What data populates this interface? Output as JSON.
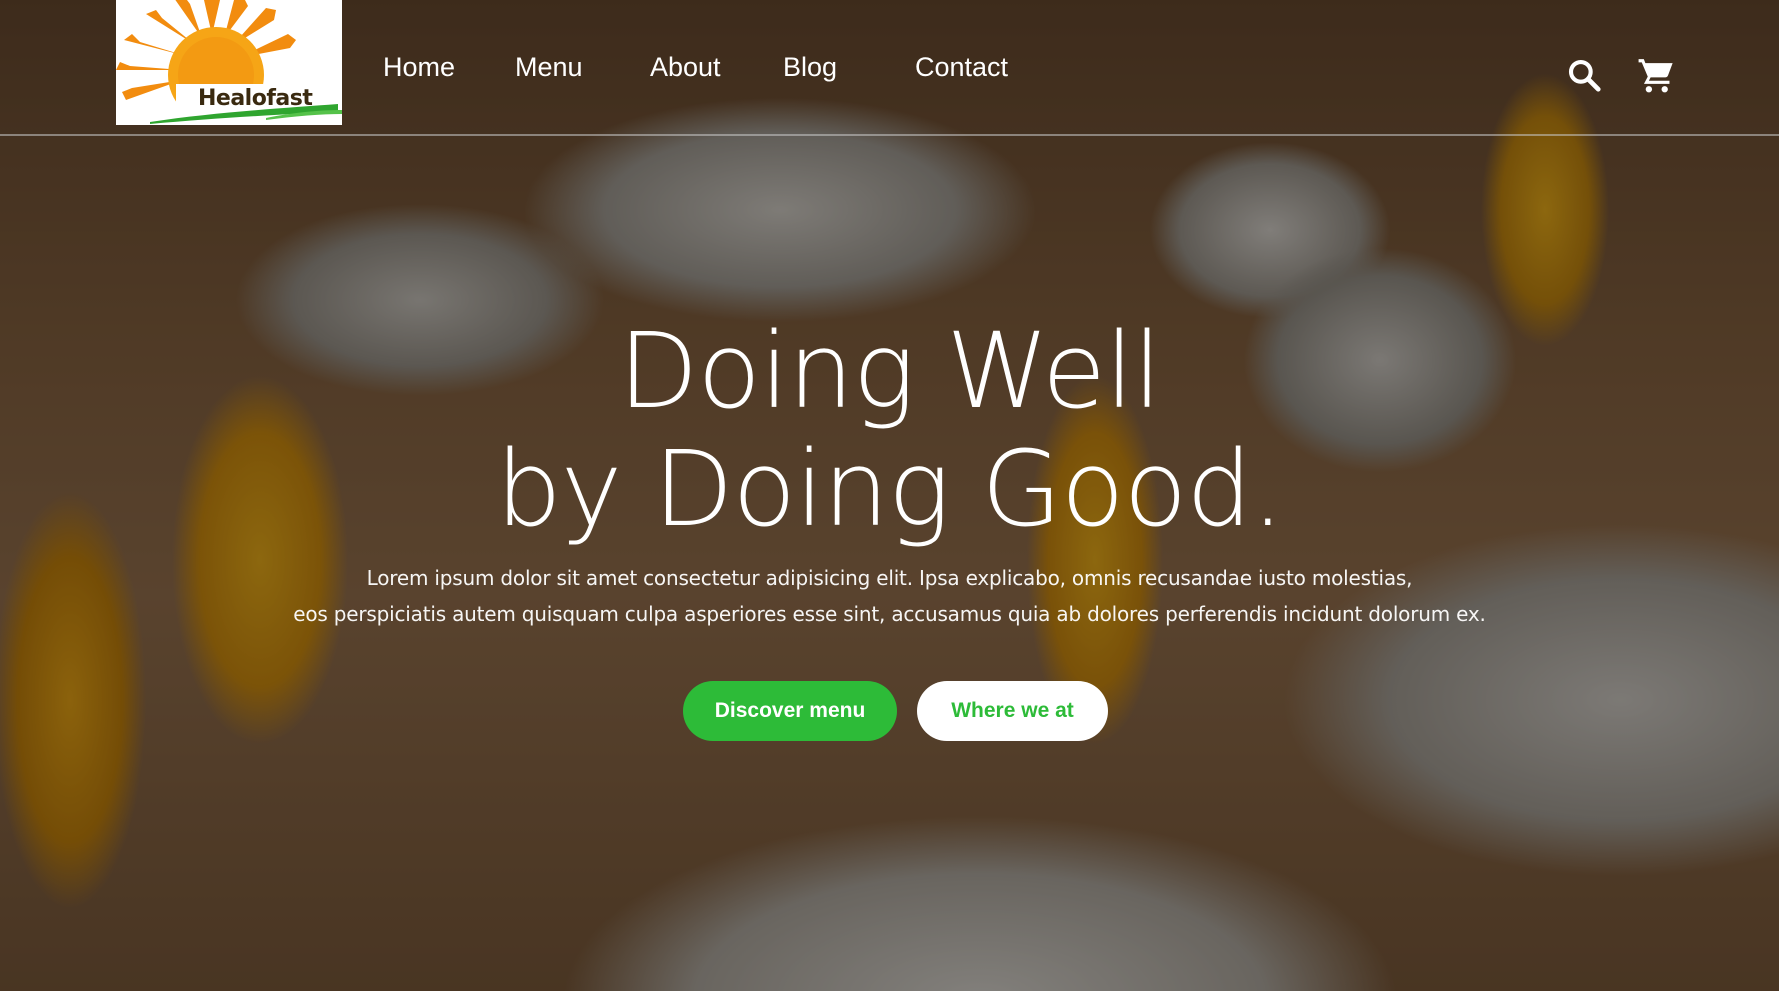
{
  "brand": {
    "name": "Healofast",
    "colors": {
      "sun_outer": "#f28c0f",
      "sun_inner": "#f6a516",
      "swoosh": "#2fa52f",
      "text": "#3a2a10"
    }
  },
  "nav": {
    "items": [
      {
        "label": "Home"
      },
      {
        "label": "Menu"
      },
      {
        "label": "About"
      },
      {
        "label": "Blog"
      },
      {
        "label": "Contact"
      }
    ],
    "icons": [
      "search-icon",
      "cart-icon"
    ]
  },
  "hero": {
    "headline_line1": "Doing Well",
    "headline_line2": "by Doing Good.",
    "subtext_line1": "Lorem ipsum dolor sit amet consectetur adipisicing elit. Ipsa explicabo, omnis recusandae iusto molestias,",
    "subtext_line2": "eos perspiciatis autem quisquam culpa asperiores esse sint, accusamus quia ab dolores perferendis incidunt dolorum ex.",
    "primary_button": "Discover menu",
    "secondary_button": "Where we at"
  },
  "colors": {
    "accent": "#2dbb38",
    "text_on_dark": "#ffffff",
    "button_secondary_bg": "#ffffff"
  }
}
